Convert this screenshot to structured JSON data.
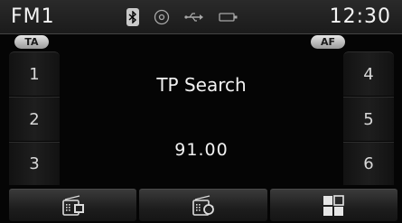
{
  "status": {
    "band": "FM1",
    "clock": "12:30",
    "icons": [
      "bluetooth-icon",
      "disc-icon",
      "usb-icon",
      "battery-icon"
    ]
  },
  "toggles": {
    "ta": "TA",
    "af": "AF"
  },
  "presets": {
    "left": [
      "1",
      "2",
      "3"
    ],
    "right": [
      "4",
      "5",
      "6"
    ]
  },
  "main": {
    "status_text": "TP Search",
    "frequency": "91.00"
  },
  "bottom_bar": {
    "buttons": [
      "radio-presets-icon",
      "radio-scan-icon",
      "menu-grid-icon"
    ]
  }
}
